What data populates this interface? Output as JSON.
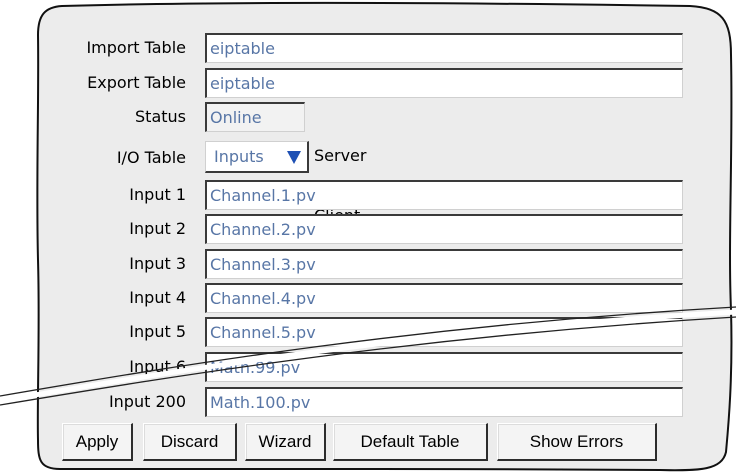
{
  "fields": {
    "import_table": {
      "label": "Import Table",
      "value": "eiptable"
    },
    "export_table": {
      "label": "Export Table",
      "value": "eiptable"
    },
    "status": {
      "label": "Status",
      "value": "Online"
    },
    "io_table": {
      "label": "I/O Table",
      "value": "Inputs",
      "direction": "Server - - > Client"
    }
  },
  "inputs": [
    {
      "label": "Input 1",
      "value": "Channel.1.pv"
    },
    {
      "label": "Input 2",
      "value": "Channel.2.pv"
    },
    {
      "label": "Input 3",
      "value": "Channel.3.pv"
    },
    {
      "label": "Input 4",
      "value": "Channel.4.pv"
    },
    {
      "label": "Input 5",
      "value": "Channel.5.pv"
    },
    {
      "label": "Input 6",
      "value": "Math.99.pv"
    },
    {
      "label": "Input 200",
      "value": "Math.100.pv"
    }
  ],
  "buttons": {
    "apply": "Apply",
    "discard": "Discard",
    "wizard": "Wizard",
    "default_table": "Default Table",
    "show_errors": "Show Errors"
  },
  "icons": {
    "dropdown": "triangle-down-icon"
  },
  "colors": {
    "panel": "#ececec",
    "value_text": "#5876a6",
    "arrow": "#1e50b4"
  }
}
